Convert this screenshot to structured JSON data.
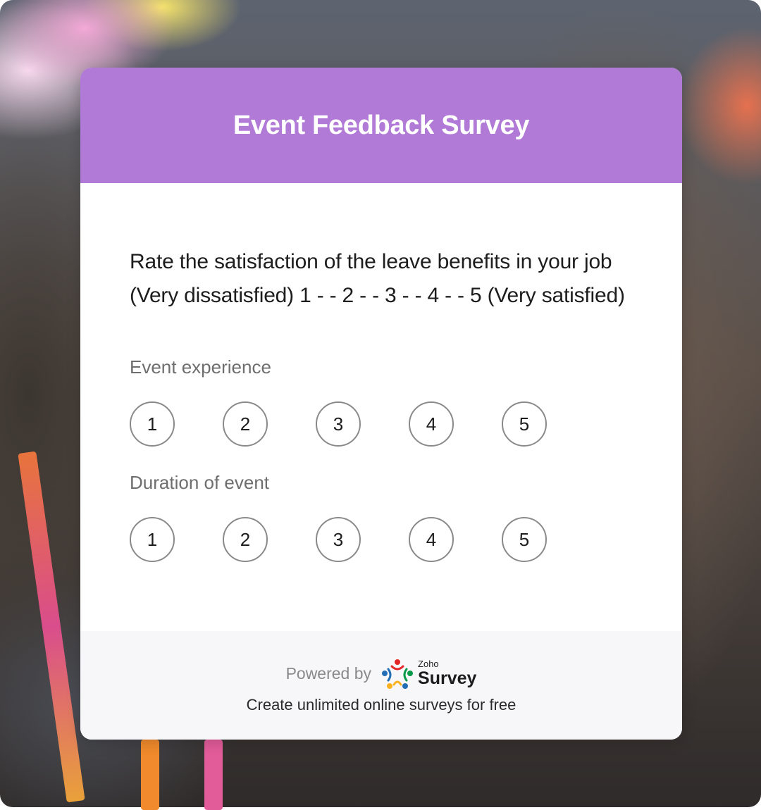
{
  "survey": {
    "title": "Event Feedback Survey",
    "question_line1": "Rate the satisfaction of the leave benefits in your job",
    "question_line2": "(Very dissatisfied) 1 - - 2 - - 3 - - 4 - - 5 (Very satisfied)",
    "rows": [
      {
        "label": "Event experience",
        "options": [
          "1",
          "2",
          "3",
          "4",
          "5"
        ]
      },
      {
        "label": "Duration of event",
        "options": [
          "1",
          "2",
          "3",
          "4",
          "5"
        ]
      }
    ]
  },
  "footer": {
    "powered_by": "Powered by",
    "logo_small": "Zoho",
    "logo_big": "Survey",
    "tagline": "Create unlimited online surveys for free"
  },
  "colors": {
    "header": "#b07ad6",
    "option_border": "#8a8a8a",
    "footer_bg": "#f7f6f8"
  },
  "icons": [
    "zoho-survey-logo-icon"
  ]
}
